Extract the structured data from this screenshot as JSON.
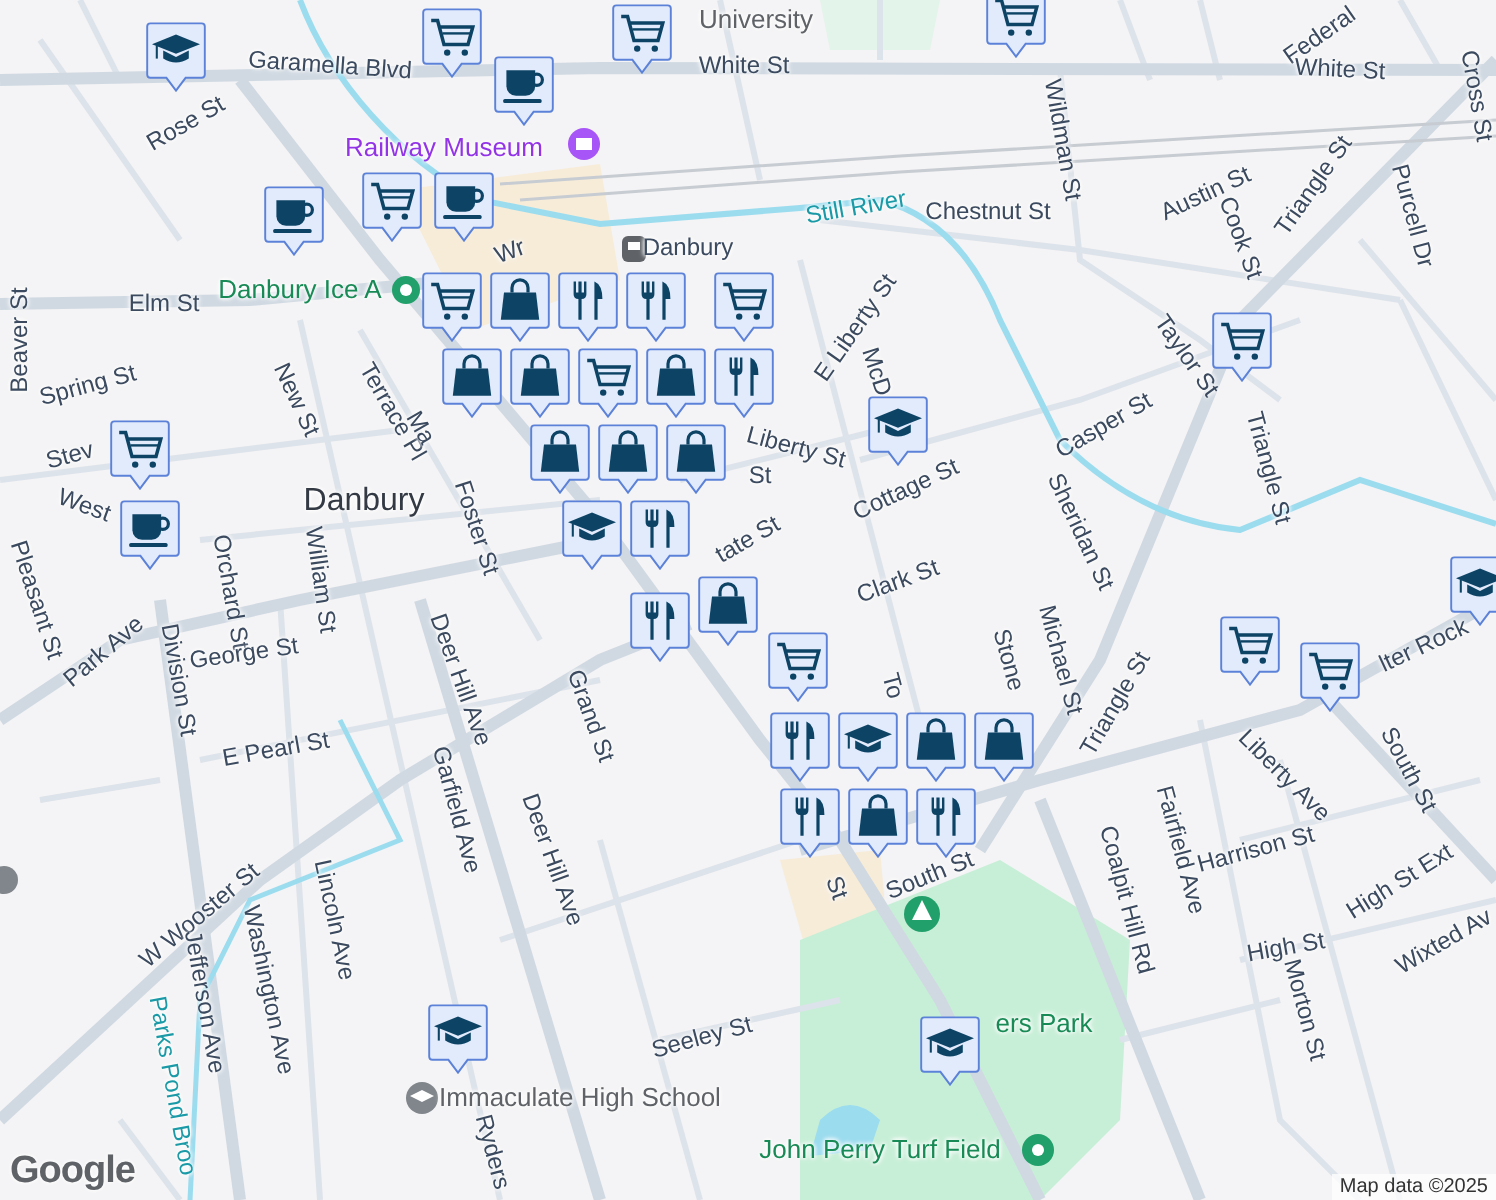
{
  "map": {
    "labels": [
      {
        "text": "University",
        "kind": "poi-gray"
      },
      {
        "text": "Federal",
        "kind": "street"
      },
      {
        "text": "Garamella Blvd",
        "kind": "street"
      },
      {
        "text": "White St",
        "kind": "street"
      },
      {
        "text": "White St",
        "kind": "street"
      },
      {
        "text": "Cross St",
        "kind": "street"
      },
      {
        "text": "Rose St",
        "kind": "street"
      },
      {
        "text": "Railway Museum",
        "kind": "poi-purple"
      },
      {
        "text": "Wildman St",
        "kind": "street"
      },
      {
        "text": "Still River",
        "kind": "water"
      },
      {
        "text": "Chestnut St",
        "kind": "street"
      },
      {
        "text": "Austin St",
        "kind": "street"
      },
      {
        "text": "Triangle St",
        "kind": "street"
      },
      {
        "text": "Purcell Dr",
        "kind": "street"
      },
      {
        "text": "Wr",
        "kind": "street"
      },
      {
        "text": "Danbury",
        "kind": "transit"
      },
      {
        "text": "Cook St",
        "kind": "street"
      },
      {
        "text": "Beaver St",
        "kind": "street"
      },
      {
        "text": "Elm St",
        "kind": "street"
      },
      {
        "text": "Danbury Ice A",
        "kind": "poi-green"
      },
      {
        "text": "E Liberty St",
        "kind": "street"
      },
      {
        "text": "McD",
        "kind": "street"
      },
      {
        "text": "Taylor St",
        "kind": "street"
      },
      {
        "text": "Spring St",
        "kind": "street"
      },
      {
        "text": "New St",
        "kind": "street"
      },
      {
        "text": "Terrace Pl",
        "kind": "street"
      },
      {
        "text": "Ma",
        "kind": "street"
      },
      {
        "text": "Liberty St",
        "kind": "street"
      },
      {
        "text": "Casper St",
        "kind": "street"
      },
      {
        "text": "Stev",
        "kind": "street"
      },
      {
        "text": "St",
        "kind": "street"
      },
      {
        "text": "Cottage St",
        "kind": "street"
      },
      {
        "text": "Triangle St",
        "kind": "street"
      },
      {
        "text": "West",
        "kind": "street"
      },
      {
        "text": "Danbury",
        "kind": "city"
      },
      {
        "text": "Foster St",
        "kind": "street"
      },
      {
        "text": "tate St",
        "kind": "street"
      },
      {
        "text": "Sheridan St",
        "kind": "street"
      },
      {
        "text": "Pleasant St",
        "kind": "street"
      },
      {
        "text": "Orchard St",
        "kind": "street"
      },
      {
        "text": "William St",
        "kind": "street"
      },
      {
        "text": "Clark St",
        "kind": "street"
      },
      {
        "text": "Park Ave",
        "kind": "street"
      },
      {
        "text": "Division St",
        "kind": "street"
      },
      {
        "text": "George St",
        "kind": "street"
      },
      {
        "text": "Deer Hill Ave",
        "kind": "street"
      },
      {
        "text": "Grand St",
        "kind": "street"
      },
      {
        "text": "To",
        "kind": "street"
      },
      {
        "text": "Stone",
        "kind": "street"
      },
      {
        "text": "Michael St",
        "kind": "street"
      },
      {
        "text": "Triangle St",
        "kind": "street"
      },
      {
        "text": "lter Rock",
        "kind": "street"
      },
      {
        "text": "E Pearl St",
        "kind": "street"
      },
      {
        "text": "Garfield Ave",
        "kind": "street"
      },
      {
        "text": "Liberty Ave",
        "kind": "street"
      },
      {
        "text": "South St",
        "kind": "street"
      },
      {
        "text": "Deer Hill Ave",
        "kind": "street"
      },
      {
        "text": "St",
        "kind": "street"
      },
      {
        "text": "South St",
        "kind": "street"
      },
      {
        "text": "Coalpit Hill Rd",
        "kind": "street"
      },
      {
        "text": "Fairfield Ave",
        "kind": "street"
      },
      {
        "text": "Harrison St",
        "kind": "street"
      },
      {
        "text": "High St Ext",
        "kind": "street"
      },
      {
        "text": "W Wooster St",
        "kind": "street"
      },
      {
        "text": "Lincoln Ave",
        "kind": "street"
      },
      {
        "text": "High St",
        "kind": "street"
      },
      {
        "text": "Wixted Av",
        "kind": "street"
      },
      {
        "text": "Jefferson Ave",
        "kind": "street"
      },
      {
        "text": "Washington Ave",
        "kind": "street"
      },
      {
        "text": "Seeley St",
        "kind": "street"
      },
      {
        "text": "ers Park",
        "kind": "poi-green"
      },
      {
        "text": "Morton St",
        "kind": "street"
      },
      {
        "text": "Parks Pond Broo",
        "kind": "water"
      },
      {
        "text": "Immaculate High School",
        "kind": "poi-gray"
      },
      {
        "text": "Ryders",
        "kind": "street"
      },
      {
        "text": "John Perry Turf Field",
        "kind": "poi-green"
      }
    ],
    "pins": [
      {
        "kind": "school"
      },
      {
        "kind": "cart"
      },
      {
        "kind": "coffee"
      },
      {
        "kind": "cart"
      },
      {
        "kind": "cart"
      },
      {
        "kind": "coffee"
      },
      {
        "kind": "cart"
      },
      {
        "kind": "coffee"
      },
      {
        "kind": "cart"
      },
      {
        "kind": "bag"
      },
      {
        "kind": "bag"
      },
      {
        "kind": "cart"
      },
      {
        "kind": "bag"
      },
      {
        "kind": "bag"
      },
      {
        "kind": "bag"
      },
      {
        "kind": "bag"
      },
      {
        "kind": "bag"
      },
      {
        "kind": "fork"
      },
      {
        "kind": "fork"
      },
      {
        "kind": "cart"
      },
      {
        "kind": "fork"
      },
      {
        "kind": "school"
      },
      {
        "kind": "cart"
      },
      {
        "kind": "cart"
      },
      {
        "kind": "coffee"
      },
      {
        "kind": "fork"
      },
      {
        "kind": "school"
      },
      {
        "kind": "bag"
      },
      {
        "kind": "fork"
      },
      {
        "kind": "cart"
      },
      {
        "kind": "school"
      },
      {
        "kind": "bag"
      },
      {
        "kind": "fork"
      },
      {
        "kind": "fork"
      },
      {
        "kind": "bag"
      },
      {
        "kind": "fork"
      },
      {
        "kind": "bag"
      },
      {
        "kind": "cart"
      },
      {
        "kind": "cart"
      },
      {
        "kind": "school"
      },
      {
        "kind": "school"
      },
      {
        "kind": "school"
      }
    ],
    "attribution": "Map data ©2025",
    "logo": "Google"
  }
}
